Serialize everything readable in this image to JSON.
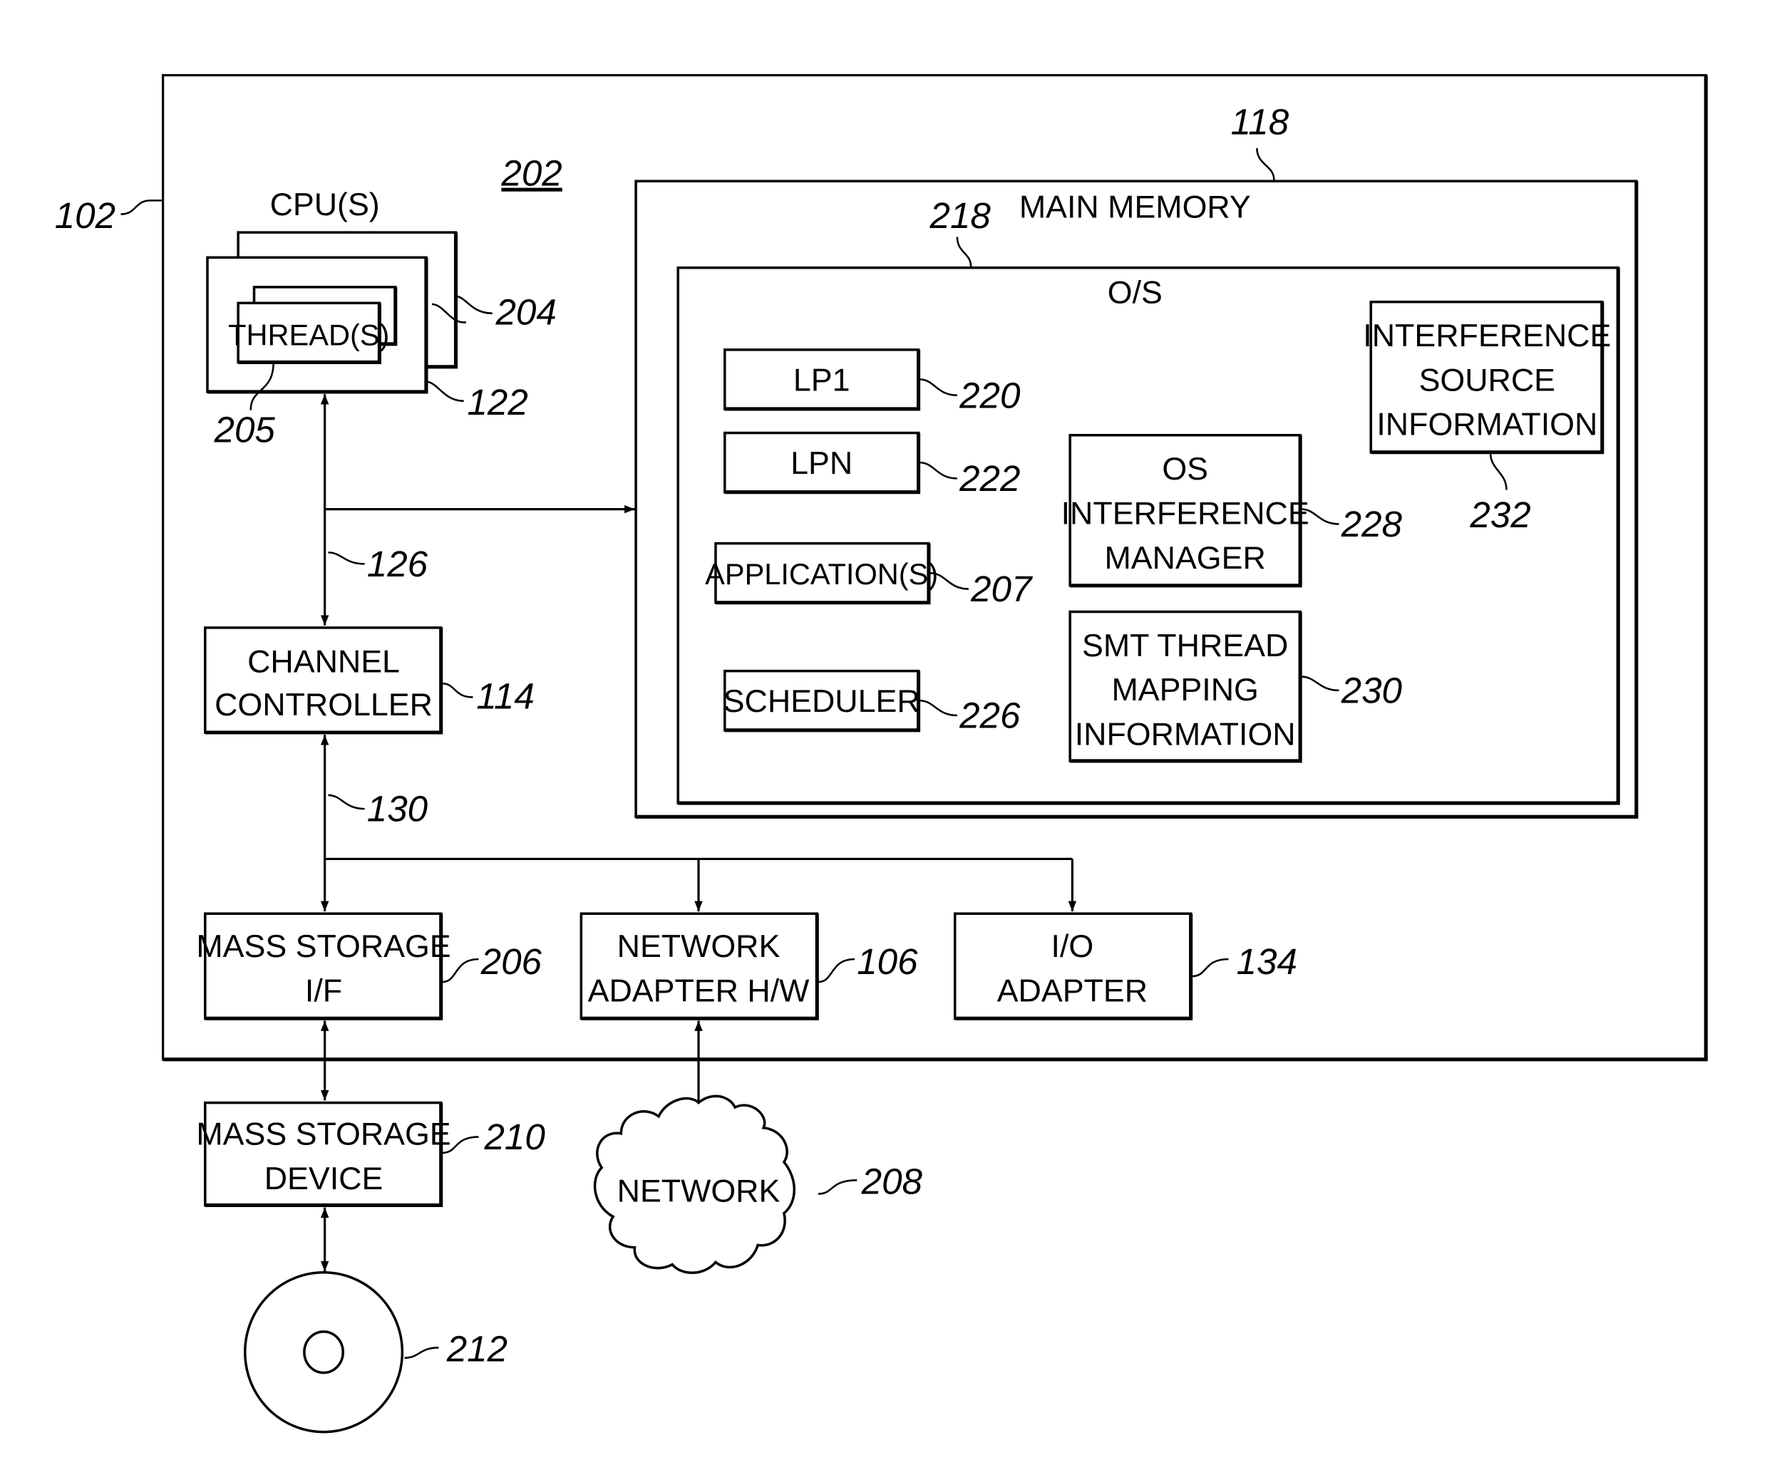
{
  "figure": {
    "system_ref": "102",
    "system_label": "202",
    "cpu": {
      "title": "CPU(S)",
      "thread_label": "THREAD(S)",
      "ref_cpu": "122",
      "ref_cpus": "204",
      "ref_thread": "205"
    },
    "main_memory": {
      "title": "MAIN MEMORY",
      "ref": "118"
    },
    "os": {
      "title": "O/S",
      "ref": "218"
    },
    "os_items": [
      {
        "label": "LP1",
        "ref": "220"
      },
      {
        "label": "LPN",
        "ref": "222"
      },
      {
        "label": "APPLICATION(S)",
        "ref": "207"
      },
      {
        "label": "SCHEDULER",
        "ref": "226"
      }
    ],
    "interference_manager": {
      "lines": [
        "OS",
        "INTERFERENCE",
        "MANAGER"
      ],
      "ref": "228"
    },
    "smt_mapping": {
      "lines": [
        "SMT THREAD",
        "MAPPING",
        "INFORMATION"
      ],
      "ref": "230"
    },
    "interference_source": {
      "lines": [
        "INTERFERENCE",
        "SOURCE",
        "INFORMATION"
      ],
      "ref": "232"
    },
    "bus_ref_1": "126",
    "bus_ref_2": "130",
    "channel_controller": {
      "lines": [
        "CHANNEL",
        "CONTROLLER"
      ],
      "ref": "114"
    },
    "mass_storage_if": {
      "lines": [
        "MASS STORAGE",
        "I/F"
      ],
      "ref": "206"
    },
    "network_adapter": {
      "lines": [
        "NETWORK",
        "ADAPTER H/W"
      ],
      "ref": "106"
    },
    "io_adapter": {
      "lines": [
        "I/O",
        "ADAPTER"
      ],
      "ref": "134"
    },
    "mass_storage_device": {
      "lines": [
        "MASS STORAGE",
        "DEVICE"
      ],
      "ref": "210"
    },
    "network": {
      "label": "NETWORK",
      "ref": "208"
    },
    "disk": {
      "ref": "212"
    }
  }
}
